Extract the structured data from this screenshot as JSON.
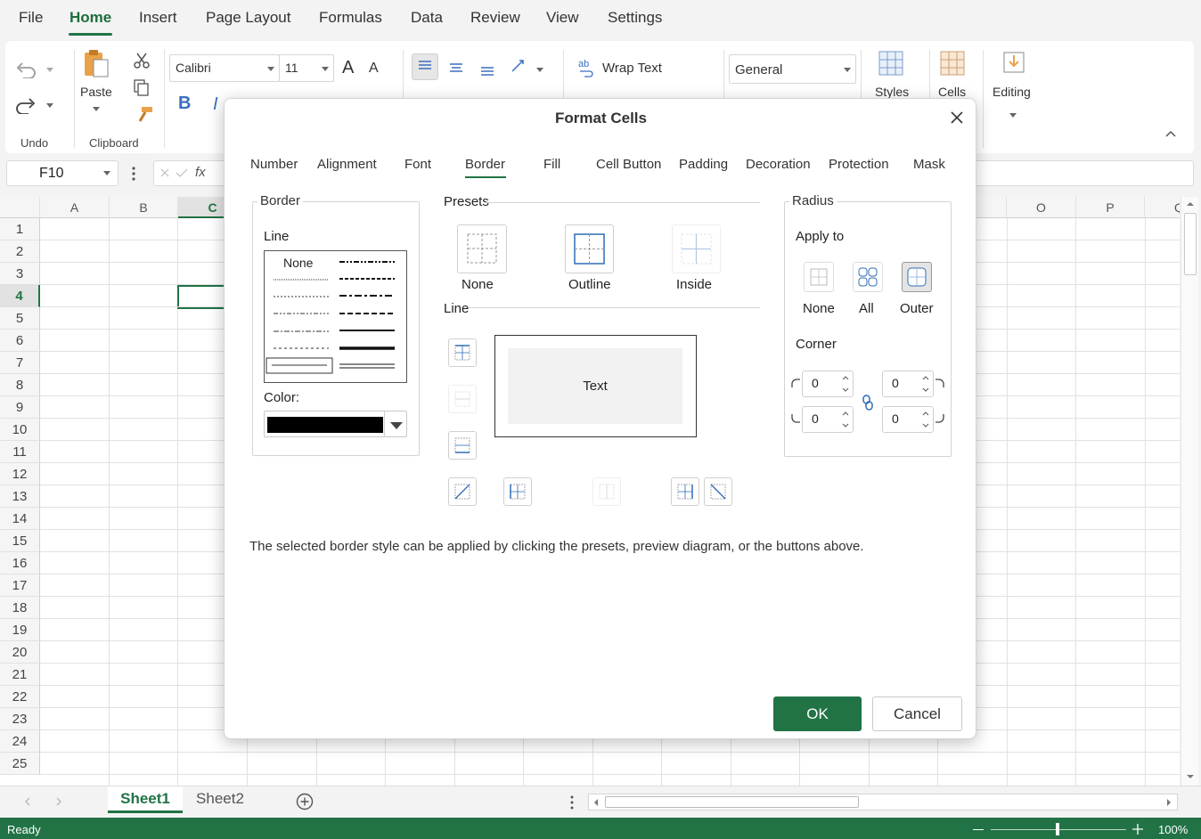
{
  "menubar": {
    "items": [
      "File",
      "Home",
      "Insert",
      "Page Layout",
      "Formulas",
      "Data",
      "Review",
      "View",
      "Settings"
    ],
    "active": "Home"
  },
  "ribbon": {
    "undo_group_label": "Undo",
    "clipboard_group_label": "Clipboard",
    "paste_label": "Paste",
    "font_name": "Calibri",
    "font_size": "11",
    "bold_label": "B",
    "italic_label": "I",
    "grow_font": "A",
    "shrink_font": "A",
    "wrap_text_label": "Wrap Text",
    "number_format": "General",
    "styles_label": "Styles",
    "cells_label": "Cells",
    "editing_label": "Editing"
  },
  "formula_bar": {
    "name_box": "F10",
    "fx_label": "fx"
  },
  "grid": {
    "columns_left": [
      "A",
      "B",
      "C"
    ],
    "columns_right": [
      "O",
      "P",
      "Q"
    ],
    "rows": [
      "1",
      "2",
      "3",
      "4",
      "5",
      "6",
      "7",
      "8",
      "9",
      "10",
      "11",
      "12",
      "13",
      "14",
      "15",
      "16",
      "17",
      "18",
      "19",
      "20",
      "21",
      "22",
      "23",
      "24",
      "25"
    ],
    "active_row": "4"
  },
  "sheets": {
    "tabs": [
      "Sheet1",
      "Sheet2"
    ],
    "active": "Sheet1"
  },
  "status": {
    "text": "Ready",
    "zoom": "100%"
  },
  "dialog": {
    "title": "Format Cells",
    "tabs": [
      "Number",
      "Alignment",
      "Font",
      "Border",
      "Fill",
      "Cell Button",
      "Padding",
      "Decoration",
      "Protection",
      "Mask"
    ],
    "active_tab": "Border",
    "border_group": {
      "title": "Border",
      "line_label": "Line",
      "none_label": "None",
      "color_label": "Color:",
      "color_value": "#000000"
    },
    "presets_group": {
      "title": "Presets",
      "items": [
        "None",
        "Outline",
        "Inside"
      ],
      "line_label": "Line",
      "preview_text": "Text"
    },
    "radius_group": {
      "title": "Radius",
      "apply_to_label": "Apply to",
      "apply_items": [
        "None",
        "All",
        "Outer"
      ],
      "selected_apply": "Outer",
      "corner_label": "Corner",
      "corners": {
        "top_left": "0",
        "top_right": "0",
        "bottom_left": "0",
        "bottom_right": "0"
      }
    },
    "hint": "The selected border style can be applied by clicking the presets, preview diagram, or the buttons above.",
    "ok_label": "OK",
    "cancel_label": "Cancel"
  }
}
